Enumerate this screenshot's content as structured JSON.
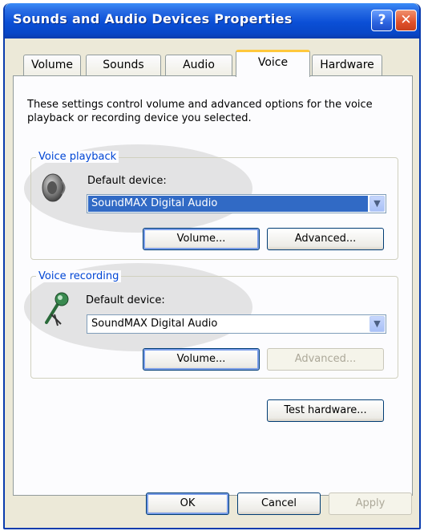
{
  "window": {
    "title": "Sounds and Audio Devices Properties",
    "help_glyph": "?",
    "close_glyph": "✕"
  },
  "tabs": [
    {
      "label": "Volume"
    },
    {
      "label": "Sounds"
    },
    {
      "label": "Audio"
    },
    {
      "label": "Voice"
    },
    {
      "label": "Hardware"
    }
  ],
  "active_tab": "Voice",
  "description": "These settings control volume and advanced options for the voice playback or recording device you selected.",
  "voice_playback": {
    "group_label": "Voice playback",
    "default_device_label": "Default device:",
    "device_value": "SoundMAX Digital Audio",
    "volume_button": "Volume...",
    "advanced_button": "Advanced..."
  },
  "voice_recording": {
    "group_label": "Voice recording",
    "default_device_label": "Default device:",
    "device_value": "SoundMAX Digital Audio",
    "volume_button": "Volume...",
    "advanced_button": "Advanced..."
  },
  "test_hardware_button": "Test hardware...",
  "footer": {
    "ok": "OK",
    "cancel": "Cancel",
    "apply": "Apply"
  },
  "colors": {
    "title_bar": "#0a4fd6",
    "group_label": "#0046d5",
    "selection": "#316ac5",
    "active_tab_highlight": "#ffc83c"
  }
}
